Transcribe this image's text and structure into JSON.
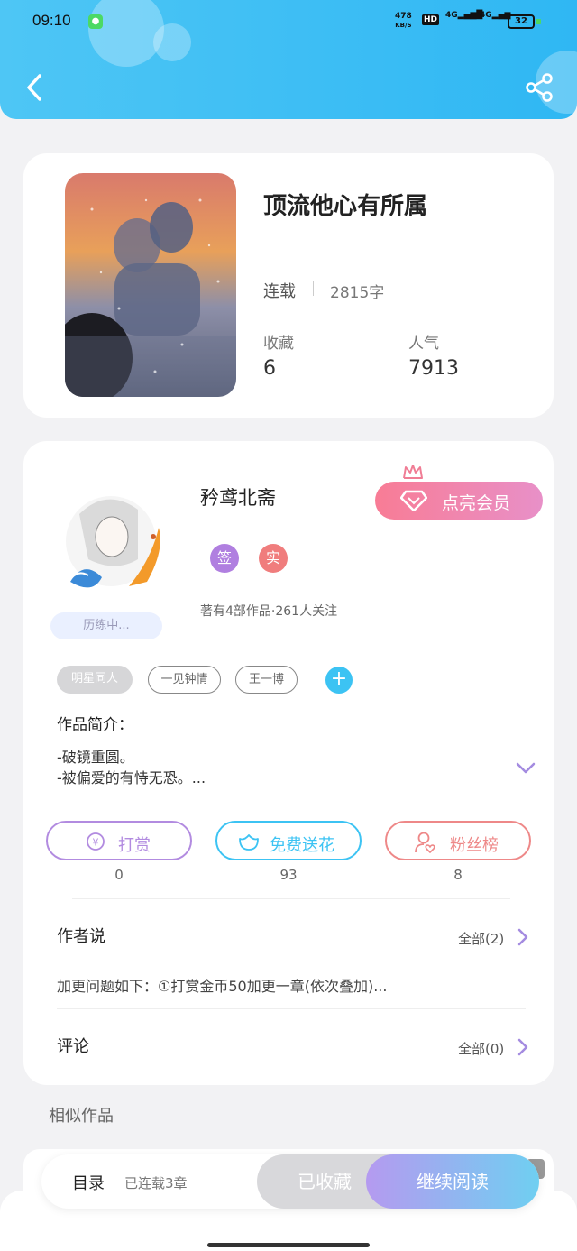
{
  "status_bar": {
    "time": "09:10",
    "net_speed": "478",
    "net_unit": "KB/S",
    "hd": "HD",
    "signal1": "4G",
    "signal2": "4G",
    "battery": "32"
  },
  "book": {
    "title": "顶流他心有所属",
    "status": "连载",
    "word_count": "2815字",
    "collect_label": "收藏",
    "collect_value": "6",
    "popularity_label": "人气",
    "popularity_value": "7913"
  },
  "author": {
    "name": "矜鸢北斋",
    "badge_sign": "签",
    "badge_real": "实",
    "summary": "著有4部作品·261人关注",
    "level": "历练中...",
    "member_button": "点亮会员"
  },
  "tags": [
    "明星同人",
    "一见钟情",
    "王一博"
  ],
  "intro": {
    "title": "作品简介：",
    "line1": "-破镜重圆。",
    "line2": "-被偏爱的有恃无恐。..."
  },
  "actions": [
    {
      "label": "打赏",
      "count": "0"
    },
    {
      "label": "免费送花",
      "count": "93"
    },
    {
      "label": "粉丝榜",
      "count": "8"
    }
  ],
  "author_says": {
    "title": "作者说",
    "all": "全部(2)",
    "content": "加更问题如下：①打赏金币50加更一章(依次叠加)..."
  },
  "comments": {
    "title": "评论",
    "all": "全部(0)"
  },
  "similar": {
    "title": "相似作品"
  },
  "bottom": {
    "catalog": "目录",
    "chapters": "已连载3章",
    "collected": "已收藏",
    "continue": "继续阅读"
  },
  "colors": {
    "header": "#2fb7f3",
    "member": "#f87c95",
    "sign_badge": "#b07fe0",
    "real_badge": "#f07d7d",
    "tip": "#b28be0",
    "flower": "#3cc3f3",
    "fans": "#ee8888"
  }
}
